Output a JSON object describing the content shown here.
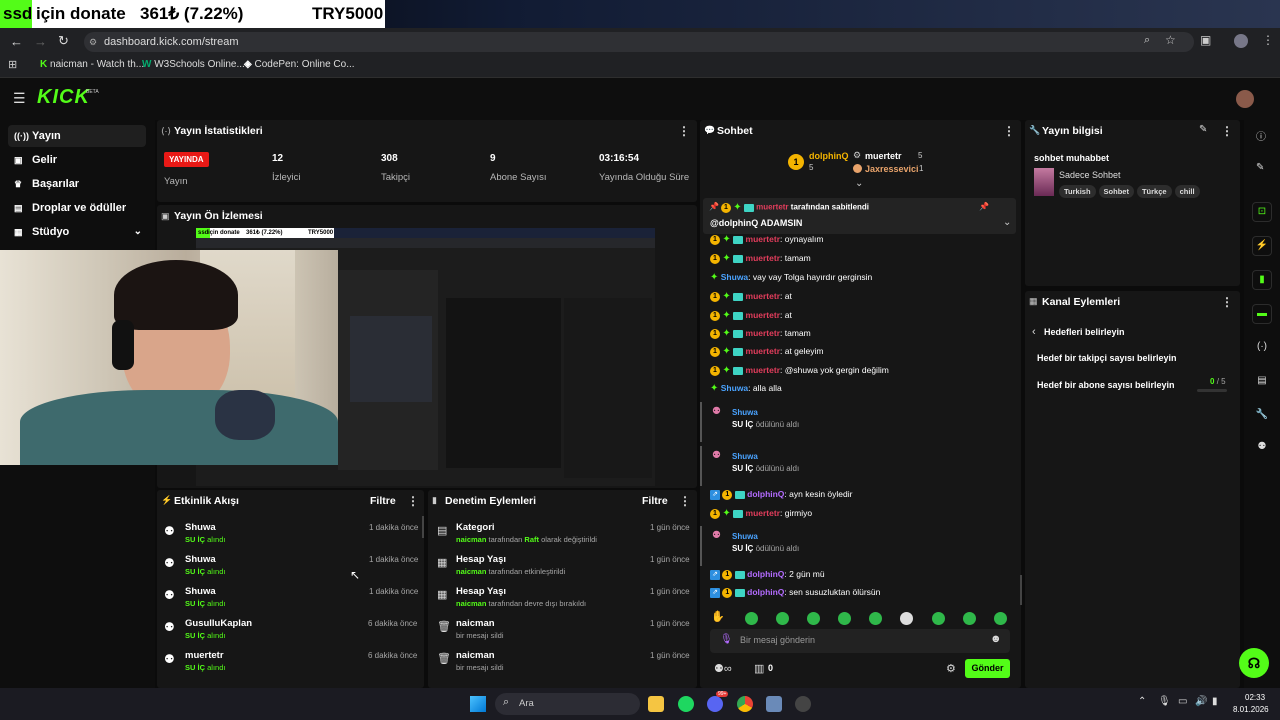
{
  "overlay": {
    "ssd": "ssd",
    "donate": "için donate",
    "amount": "361₺ (7.22%)",
    "goal": "TRY5000"
  },
  "browser": {
    "url": "dashboard.kick.com/stream",
    "bookmarks": [
      "naicman - Watch th...",
      "W3Schools Online...",
      "CodePen: Online Co..."
    ]
  },
  "kick": {
    "logo": "KICK",
    "beta": "BETA"
  },
  "sidebar": {
    "items": [
      {
        "label": "Yayın"
      },
      {
        "label": "Gelir"
      },
      {
        "label": "Başarılar"
      },
      {
        "label": "Droplar ve ödüller"
      },
      {
        "label": "Stüdyo"
      }
    ]
  },
  "stats": {
    "title": "Yayın İstatistikleri",
    "live_badge": "YAYINDA",
    "cols": [
      {
        "value": "",
        "label": "Yayın"
      },
      {
        "value": "12",
        "label": "İzleyici"
      },
      {
        "value": "308",
        "label": "Takipçi"
      },
      {
        "value": "9",
        "label": "Abone Sayısı"
      },
      {
        "value": "03:16:54",
        "label": "Yayında Olduğu Süre"
      }
    ]
  },
  "preview": {
    "title": "Yayın Ön İzlemesi",
    "ssd": "ssd",
    "donate": "için donate",
    "amount": "361₺ (7.22%)",
    "goal": "TRY5000"
  },
  "activity": {
    "title": "Etkinlik Akışı",
    "filter": "Filtre",
    "rows": [
      {
        "name": "Shuwa",
        "sub": "SU İÇ",
        "action": "alındı",
        "time": "1 dakika önce"
      },
      {
        "name": "Shuwa",
        "sub": "SU İÇ",
        "action": "alındı",
        "time": "1 dakika önce"
      },
      {
        "name": "Shuwa",
        "sub": "SU İÇ",
        "action": "alındı",
        "time": "1 dakika önce"
      },
      {
        "name": "GusulluKaplan",
        "sub": "SU İÇ",
        "action": "alındı",
        "time": "6 dakika önce"
      },
      {
        "name": "muertetr",
        "sub": "SU İÇ",
        "action": "alındı",
        "time": "6 dakika önce"
      }
    ]
  },
  "moderation": {
    "title": "Denetim Eylemleri",
    "filter": "Filtre",
    "rows": [
      {
        "name": "Kategori",
        "user": "naicman",
        "text": "tarafından",
        "hl": "Raft",
        "rest": "olarak değiştirildi",
        "time": "1 gün önce",
        "icon": "category-icon"
      },
      {
        "name": "Hesap Yaşı",
        "user": "naicman",
        "text": "tarafından etkinleştirildi",
        "hl": "",
        "rest": "",
        "time": "1 gün önce",
        "icon": "calendar-icon"
      },
      {
        "name": "Hesap Yaşı",
        "user": "naicman",
        "text": "tarafından devre dışı bırakıldı",
        "hl": "",
        "rest": "",
        "time": "1 gün önce",
        "icon": "calendar-icon"
      },
      {
        "name": "naicman",
        "user": "",
        "text": "bir mesajı sildi",
        "hl": "",
        "rest": "",
        "time": "1 gün önce",
        "icon": "trash-icon"
      },
      {
        "name": "naicman",
        "user": "",
        "text": "bir mesajı sildi",
        "hl": "",
        "rest": "",
        "time": "1 gün önce",
        "icon": "trash-icon"
      }
    ]
  },
  "chat": {
    "title": "Sohbet",
    "top": [
      {
        "rank": "1",
        "name": "dolphinQ",
        "count": "5"
      },
      {
        "rank": "",
        "name": "muertetr",
        "count": "5"
      },
      {
        "rank": "",
        "name": "Jaxressevici",
        "count": "1"
      }
    ],
    "pinned_by": "tarafından sabitlendi",
    "pinned_user": "muertetr",
    "pinned_msg": "@dolphinQ ADAMSIN",
    "partial": "oynayalım",
    "messages": [
      {
        "type": "msg",
        "user": "muertetr",
        "color": "red",
        "badges": "full",
        "text": "tamam"
      },
      {
        "type": "msg",
        "user": "Shuwa",
        "color": "blue",
        "badges": "diamond",
        "text": "vay vay Tolga hayırdır gerginsin"
      },
      {
        "type": "msg",
        "user": "muertetr",
        "color": "red",
        "badges": "full",
        "text": "at"
      },
      {
        "type": "msg",
        "user": "muertetr",
        "color": "red",
        "badges": "full",
        "text": "at"
      },
      {
        "type": "msg",
        "user": "muertetr",
        "color": "red",
        "badges": "full",
        "text": "tamam"
      },
      {
        "type": "msg",
        "user": "muertetr",
        "color": "red",
        "badges": "full",
        "text": "at geleyim"
      },
      {
        "type": "msg",
        "user": "muertetr",
        "color": "red",
        "badges": "full",
        "text": "@shuwa yok gergin değilim"
      },
      {
        "type": "msg",
        "user": "Shuwa",
        "color": "blue",
        "badges": "diamond",
        "text": "alla alla"
      },
      {
        "type": "reward",
        "user": "Shuwa",
        "reward": "SU İÇ",
        "text": "ödülünü aldı"
      },
      {
        "type": "reward",
        "user": "Shuwa",
        "reward": "SU İÇ",
        "text": "ödülünü aldı"
      },
      {
        "type": "msg",
        "user": "dolphinQ",
        "color": "purple",
        "badges": "vip",
        "text": "ayn kesin öyledir"
      },
      {
        "type": "msg",
        "user": "muertetr",
        "color": "red",
        "badges": "full",
        "text": "girmiyo"
      },
      {
        "type": "reward",
        "user": "Shuwa",
        "reward": "SU İÇ",
        "text": "ödülünü aldı"
      },
      {
        "type": "msg",
        "user": "dolphinQ",
        "color": "purple",
        "badges": "vip",
        "text": "2 gün mü"
      },
      {
        "type": "msg",
        "user": "dolphinQ",
        "color": "purple",
        "badges": "vip",
        "text": "sen susuzluktan ölürsün"
      }
    ],
    "input_placeholder": "Bir mesaj gönderin",
    "points": "0",
    "send": "Gönder"
  },
  "info": {
    "title": "Yayın bilgisi",
    "stream_title": "sohbet muhabbet",
    "category": "Sadece Sohbet",
    "tags": [
      "Turkish",
      "Sohbet",
      "Türkçe",
      "chill"
    ]
  },
  "channel": {
    "title": "Kanal Eylemleri",
    "back": "Hedefleri belirleyin",
    "follow_goal": "Hedef bir takipçi sayısı belirleyin",
    "sub_goal": "Hedef bir abone sayısı belirleyin",
    "sub_progress": "0",
    "sub_total": "/ 5"
  },
  "taskbar": {
    "search": "Ara",
    "time": "02:33",
    "date": "8.01.2026",
    "badge": "99+"
  },
  "colors": {
    "accent": "#53fc18",
    "live": "#e91916",
    "bg": "#0b0b0b",
    "panel": "#161616"
  }
}
